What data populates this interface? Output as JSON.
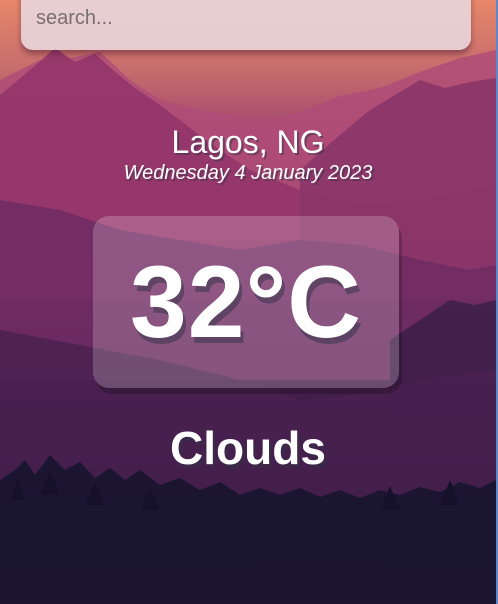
{
  "search": {
    "placeholder": "search...",
    "value": ""
  },
  "location": {
    "city_country": "Lagos, NG",
    "date": "Wednesday 4 January 2023"
  },
  "weather": {
    "temperature": "32°C",
    "condition": "Clouds"
  },
  "colors": {
    "sky_top": "#e8876a",
    "sky_mid": "#a3476f",
    "ground_dark": "#141026",
    "search_bg": "#e8d6dc",
    "text": "#ffffff"
  }
}
